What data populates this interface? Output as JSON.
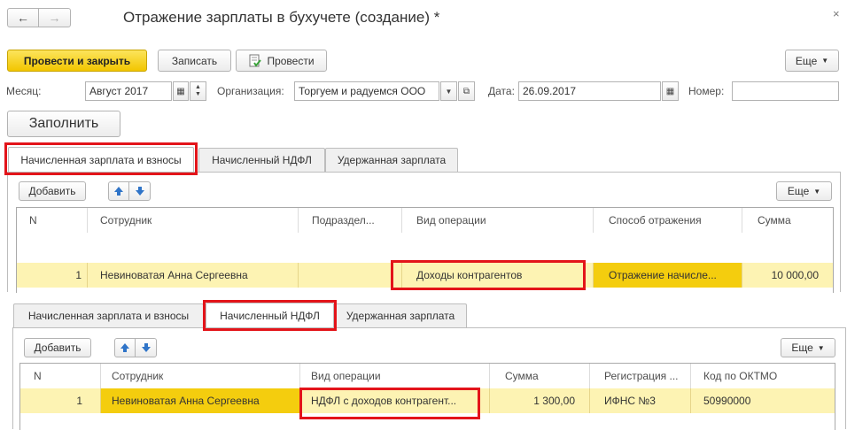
{
  "window": {
    "title": "Отражение зарплаты в бухучете (создание) *",
    "close_glyph": "×"
  },
  "toolbar": {
    "post_close_label": "Провести и закрыть",
    "save_label": "Записать",
    "post_label": "Провести",
    "more_label": "Еще"
  },
  "form": {
    "month_label": "Месяц:",
    "month_value": "Август 2017",
    "org_label": "Организация:",
    "org_value": "Торгуем и радуемся ООО",
    "date_label": "Дата:",
    "date_value": "26.09.2017",
    "number_label": "Номер:",
    "number_value": "",
    "fill_label": "Заполнить"
  },
  "section1": {
    "tabs": [
      "Начисленная зарплата и взносы",
      "Начисленный НДФЛ",
      "Удержанная зарплата"
    ],
    "add_label": "Добавить",
    "more_label": "Еще",
    "columns": [
      "N",
      "Сотрудник",
      "Подраздел...",
      "Вид операции",
      "Способ отражения",
      "Сумма"
    ],
    "row": {
      "n": "1",
      "employee": "Невиноватая Анна Сергеевна",
      "department": "",
      "operation": "Доходы контрагентов",
      "method": "Отражение начисле...",
      "sum": "10 000,00"
    }
  },
  "section2": {
    "tabs": [
      "Начисленная зарплата и взносы",
      "Начисленный НДФЛ",
      "Удержанная зарплата"
    ],
    "add_label": "Добавить",
    "more_label": "Еще",
    "columns": [
      "N",
      "Сотрудник",
      "Вид операции",
      "Сумма",
      "Регистрация ...",
      "Код по ОКТМО"
    ],
    "row": {
      "n": "1",
      "employee": "Невиноватая Анна Сергеевна",
      "operation": "НДФЛ с доходов контрагент...",
      "sum": "1 300,00",
      "registration": "ИФНС №3",
      "oktmo": "50990000"
    }
  },
  "colors": {
    "accent_yellow": "#f4cd0e",
    "row_highlight": "#fdf3b3",
    "cell_selected": "#f4cd0e",
    "annotation_red": "#e3141a"
  }
}
